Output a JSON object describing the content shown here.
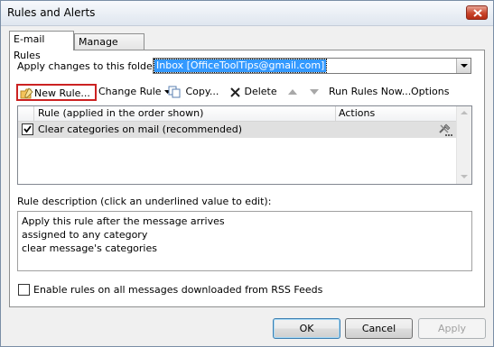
{
  "window": {
    "title": "Rules and Alerts"
  },
  "tabs": [
    {
      "label": "E-mail Rules",
      "active": true
    },
    {
      "label": "Manage Alerts",
      "active": false
    }
  ],
  "folder": {
    "label": "Apply changes to this folder:",
    "value": "Inbox [OfficeToolTips@gmail.com]"
  },
  "toolbar": {
    "new_rule": "New Rule...",
    "change_rule": "Change Rule",
    "copy": "Copy...",
    "delete": "Delete",
    "run_rules": "Run Rules Now...",
    "options": "Options"
  },
  "rules_table": {
    "headers": {
      "rule": "Rule (applied in the order shown)",
      "actions": "Actions"
    },
    "rows": [
      {
        "checked": true,
        "name": "Clear categories on mail (recommended)"
      }
    ]
  },
  "description": {
    "label": "Rule description (click an underlined value to edit):",
    "lines": [
      "Apply this rule after the message arrives",
      "assigned to any category",
      "clear message's categories"
    ]
  },
  "rss": {
    "checked": false,
    "label": "Enable rules on all messages downloaded from RSS Feeds"
  },
  "buttons": {
    "ok": "OK",
    "cancel": "Cancel",
    "apply": "Apply"
  }
}
